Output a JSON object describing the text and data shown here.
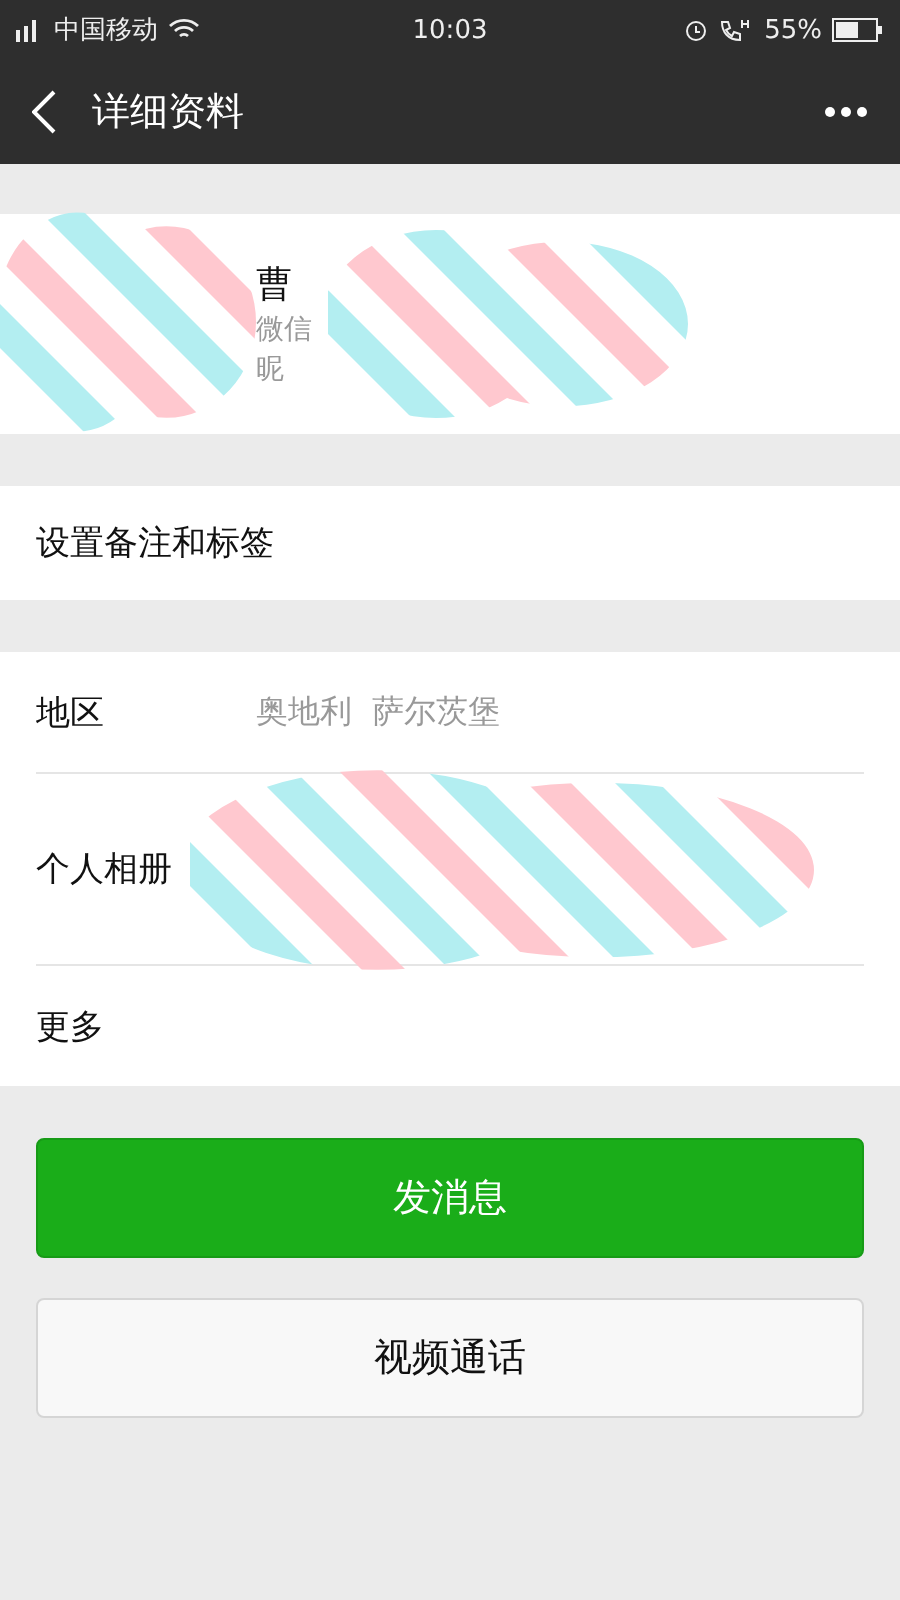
{
  "status_bar": {
    "carrier": "中国移动",
    "time": "10:03",
    "battery": "55%"
  },
  "header": {
    "title": "详细资料"
  },
  "profile": {
    "name": "曹",
    "wechat_id": "微信",
    "nickname": "昵"
  },
  "remark_row": {
    "label": "设置备注和标签"
  },
  "info_rows": [
    {
      "kind": "text",
      "label": "地区",
      "value": "奥地利  萨尔茨堡"
    },
    {
      "kind": "album",
      "label": "个人相册"
    },
    {
      "kind": "text",
      "label": "更多"
    }
  ],
  "buttons": [
    {
      "kind": "primary",
      "label": "发消息"
    },
    {
      "kind": "secondary",
      "label": "视频通话"
    }
  ]
}
